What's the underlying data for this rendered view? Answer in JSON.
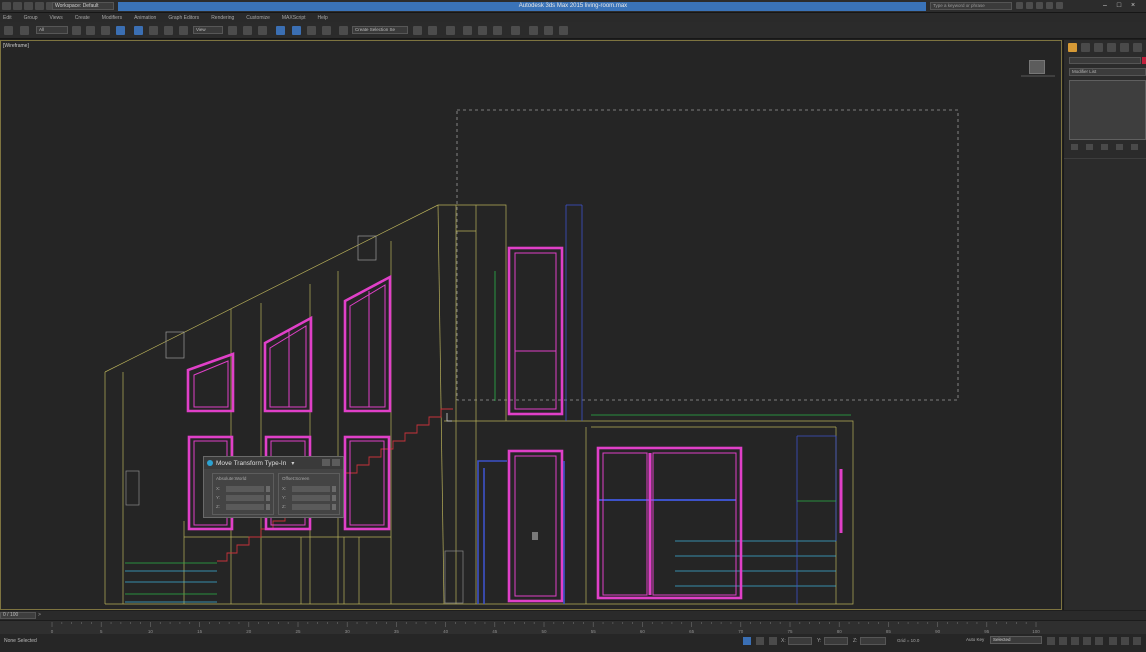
{
  "titlebar": {
    "app_title": "Autodesk 3ds Max  2015    living-room.max",
    "workspace": "Workspace: Default",
    "search_placeholder": "Type a keyword or phrase"
  },
  "menu": [
    "Edit",
    "Group",
    "Views",
    "Create",
    "Modifiers",
    "Animation",
    "Graph Editors",
    "Rendering",
    "Customize",
    "MAXScript",
    "Help"
  ],
  "toolbar": {
    "selection_filter": "All",
    "reference_coord": "View",
    "named_selection": "Create Selection Se"
  },
  "viewport": {
    "label": "[Wireframe]"
  },
  "dialog": {
    "title": "Move Transform Type-In",
    "absolute_label": "Absolute:World",
    "offset_label": "Offset:Screen",
    "axes": [
      "X:",
      "Y:",
      "Z:"
    ]
  },
  "command_panel": {
    "modifier_list": "Modifier List"
  },
  "timeline": {
    "frame_label": "0 / 100",
    "ticks": [
      "0",
      "5",
      "10",
      "15",
      "20",
      "25",
      "30",
      "35",
      "40",
      "45",
      "50",
      "55",
      "60",
      "65",
      "70",
      "75",
      "80",
      "85",
      "90",
      "95",
      "100"
    ]
  },
  "statusbar": {
    "status_text": "None Selected",
    "x_label": "X:",
    "y_label": "Y:",
    "z_label": "Z:",
    "grid_text": "Grid = 10.0",
    "autokey_label": "Auto Key",
    "selected_value": "Selected"
  },
  "colors": {
    "accent": "#3a73b8",
    "magenta": "#e040c8",
    "viewport_border": "#7e7440"
  },
  "icons": [
    "undo-icon",
    "redo-icon",
    "select-icon",
    "move-icon",
    "rotate-icon",
    "scale-icon",
    "snap-icon",
    "mirror-icon",
    "align-icon",
    "render-icon",
    "create-tab-icon",
    "modify-tab-icon",
    "hierarchy-tab-icon",
    "motion-tab-icon",
    "display-tab-icon",
    "utilities-tab-icon",
    "play-icon",
    "key-icon"
  ]
}
